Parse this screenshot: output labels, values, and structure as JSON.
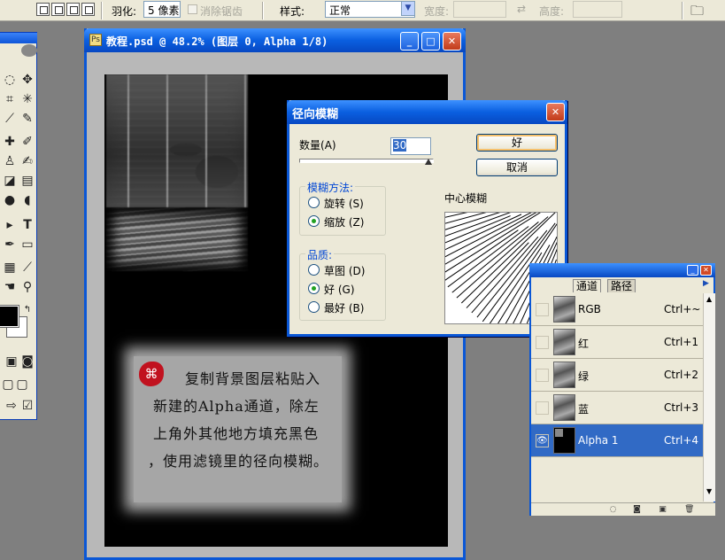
{
  "options_bar": {
    "feather_label": "羽化:",
    "feather_value": "5 像素",
    "antialias_label": "消除锯齿",
    "style_label": "样式:",
    "style_value": "正常",
    "width_label": "宽度:",
    "height_label": "高度:"
  },
  "document": {
    "title": "教程.psd @ 48.2% (图层 0, Alpha 1/8)",
    "tutorial_lines": [
      "复制背景图层粘贴入",
      "新建的Alpha通道，除左",
      "上角外其他地方填充黑色",
      "，使用滤镜里的径向模糊。"
    ]
  },
  "dialog": {
    "title": "径向模糊",
    "amount_label": "数量",
    "amount_hotkey": "(A)",
    "amount_value": "30",
    "amount_fraction": 0.3,
    "ok_label": "好",
    "cancel_label": "取消",
    "method_group": "模糊方法:",
    "method_options": [
      {
        "label": "旋转",
        "hotkey": "(S)",
        "selected": false
      },
      {
        "label": "缩放",
        "hotkey": "(Z)",
        "selected": true
      }
    ],
    "quality_group": "品质:",
    "quality_options": [
      {
        "label": "草图",
        "hotkey": "(D)",
        "selected": false
      },
      {
        "label": "好",
        "hotkey": "(G)",
        "selected": true
      },
      {
        "label": "最好",
        "hotkey": "(B)",
        "selected": false
      }
    ],
    "center_label": "中心模糊"
  },
  "channels_panel": {
    "tabs": [
      "通道",
      "路径"
    ],
    "rows": [
      {
        "name": "RGB",
        "shortcut": "Ctrl+~",
        "selected": false,
        "visible": false
      },
      {
        "name": "红",
        "shortcut": "Ctrl+1",
        "selected": false,
        "visible": false
      },
      {
        "name": "绿",
        "shortcut": "Ctrl+2",
        "selected": false,
        "visible": false
      },
      {
        "name": "蓝",
        "shortcut": "Ctrl+3",
        "selected": false,
        "visible": false
      },
      {
        "name": "Alpha 1",
        "shortcut": "Ctrl+4",
        "selected": true,
        "visible": true
      }
    ]
  },
  "toolbox": {
    "tools": [
      "lasso-icon",
      "move-icon",
      "crop-icon",
      "slice-icon",
      "healing-brush-icon",
      "brush-icon",
      "clone-stamp-icon",
      "history-brush-icon",
      "eraser-icon",
      "gradient-icon",
      "blur-icon",
      "dodge-icon",
      "path-selection-icon",
      "type-icon",
      "pen-icon",
      "rectangle-icon",
      "notes-icon",
      "eyedropper-icon",
      "hand-icon",
      "zoom-icon"
    ]
  }
}
